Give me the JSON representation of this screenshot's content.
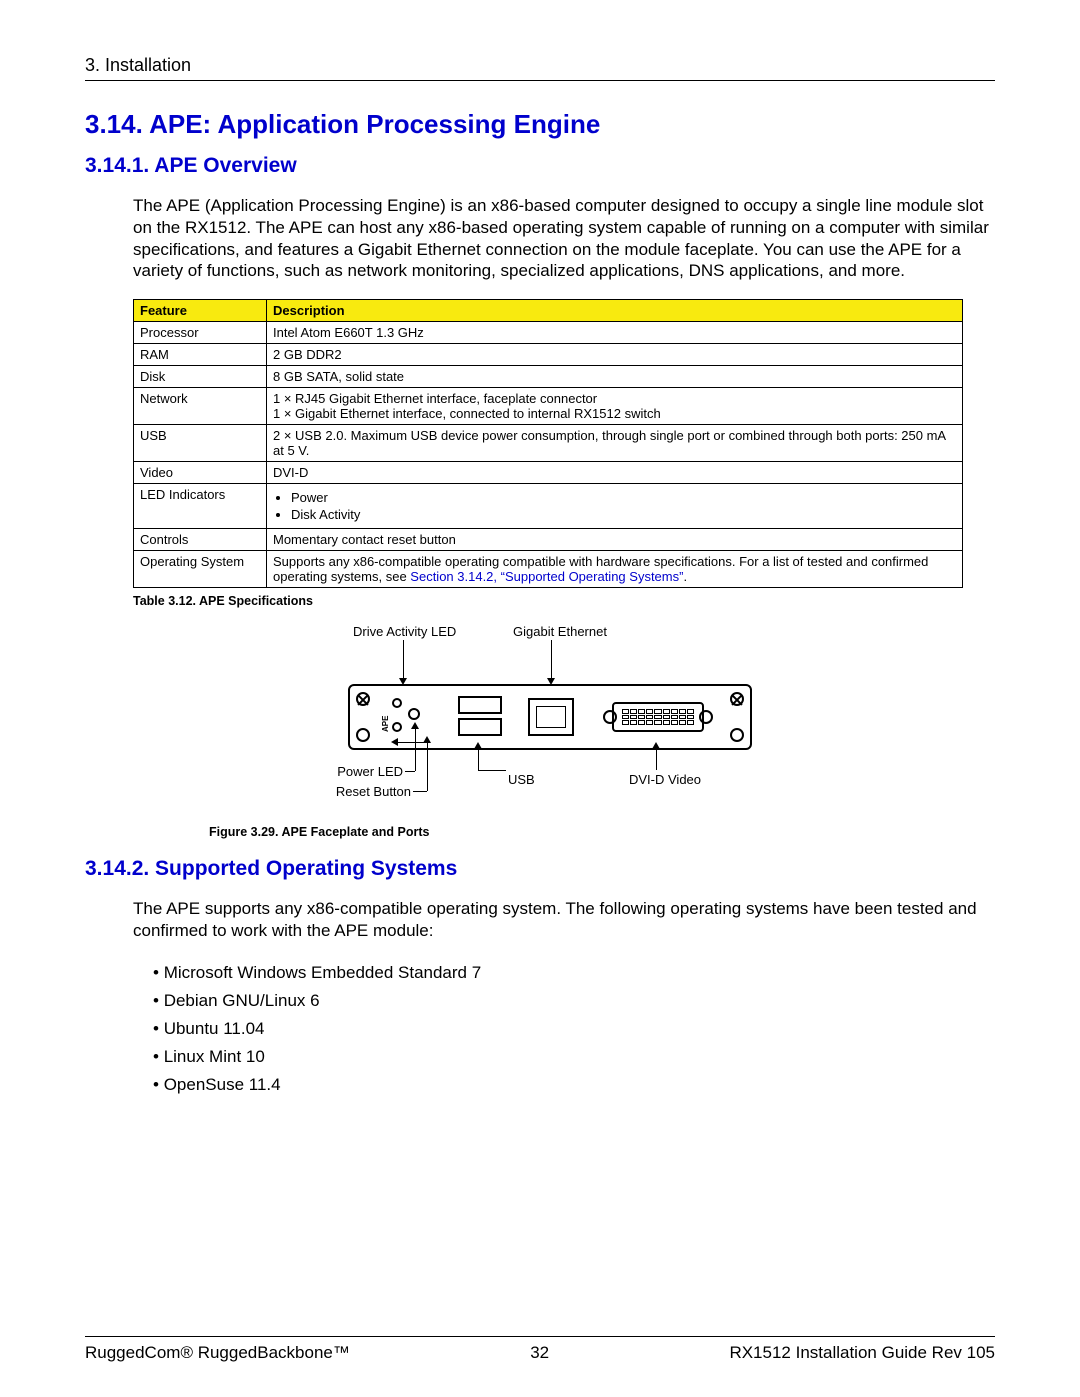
{
  "breadcrumb": "3. Installation",
  "section": {
    "title": "3.14. APE: Application Processing Engine",
    "sub1_title": "3.14.1. APE Overview",
    "sub1_body": "The APE (Application Processing Engine) is an x86-based computer designed to occupy a single line module slot on the RX1512. The APE can host any x86-based operating system capable of running on a computer with similar specifications, and features a Gigabit Ethernet connection on the module faceplate. You can use the APE for a variety of functions, such as network monitoring, specialized applications, DNS applications, and more.",
    "sub2_title": "3.14.2. Supported Operating Systems",
    "sub2_body": "The APE supports any x86-compatible operating system. The following operating systems have been tested and confirmed to work with the APE module:"
  },
  "spec_table": {
    "headers": {
      "c0": "Feature",
      "c1": "Description"
    },
    "rows": {
      "r0": {
        "f": "Processor",
        "d": "Intel Atom E660T 1.3 GHz"
      },
      "r1": {
        "f": "RAM",
        "d": "2 GB DDR2"
      },
      "r2": {
        "f": "Disk",
        "d": "8 GB SATA, solid state"
      },
      "r3": {
        "f": "Network",
        "d": "1 × RJ45 Gigabit Ethernet interface, faceplate connector\n1 × Gigabit Ethernet interface, connected to internal RX1512 switch"
      },
      "r4": {
        "f": "USB",
        "d": "2 × USB 2.0. Maximum USB device power consumption, through single port or combined through both ports: 250 mA at 5 V."
      },
      "r5": {
        "f": "Video",
        "d": "DVI-D"
      },
      "r6": {
        "f": "LED Indicators",
        "li0": "Power",
        "li1": "Disk Activity"
      },
      "r7": {
        "f": "Controls",
        "d": "Momentary contact reset button"
      },
      "r8": {
        "f": "Operating System",
        "d_pre": "Supports any x86-compatible operating compatible with hardware specifications. For a list of tested and confirmed operating systems, see ",
        "d_link": "Section 3.14.2, “Supported Operating Systems”",
        "d_post": "."
      }
    },
    "caption": "Table 3.12. APE Specifications"
  },
  "figure": {
    "labels": {
      "drive_led": "Drive Activity LED",
      "gbe": "Gigabit Ethernet",
      "power_led": "Power LED",
      "reset": "Reset Button",
      "usb": "USB",
      "dvi": "DVI-D Video",
      "ape_marking": "APE"
    },
    "caption": "Figure 3.29. APE Faceplate and Ports"
  },
  "os_list": {
    "i0": "Microsoft Windows Embedded Standard 7",
    "i1": "Debian GNU/Linux 6",
    "i2": "Ubuntu 11.04",
    "i3": "Linux Mint 10",
    "i4": "OpenSuse 11.4"
  },
  "footer": {
    "left": "RuggedCom® RuggedBackbone™",
    "center": "32",
    "right": "RX1512 Installation Guide Rev 105"
  }
}
